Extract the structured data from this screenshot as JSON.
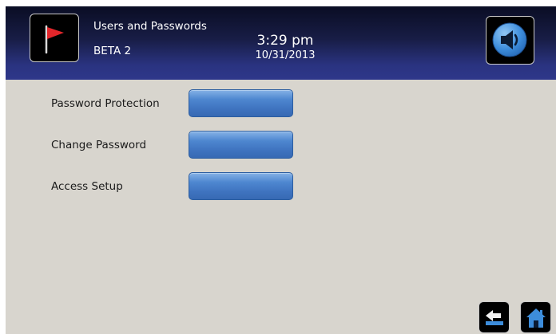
{
  "header": {
    "title": "Users and Passwords",
    "subtitle": "BETA 2",
    "time": "3:29 pm",
    "date": "10/31/2013",
    "left_icon": "red-flag-icon",
    "right_icon": "speaker-icon"
  },
  "settings": {
    "rows": [
      {
        "label": "Password Protection",
        "button_label": ""
      },
      {
        "label": "Change Password",
        "button_label": ""
      },
      {
        "label": "Access Setup",
        "button_label": ""
      }
    ]
  },
  "footer": {
    "back_icon": "back-arrow-icon",
    "home_icon": "home-icon"
  },
  "colors": {
    "header_top": "#0a0d24",
    "header_bottom": "#2e378a",
    "background": "#d8d5ce",
    "button_blue": "#4e87d0",
    "flag_red": "#e3262b"
  }
}
